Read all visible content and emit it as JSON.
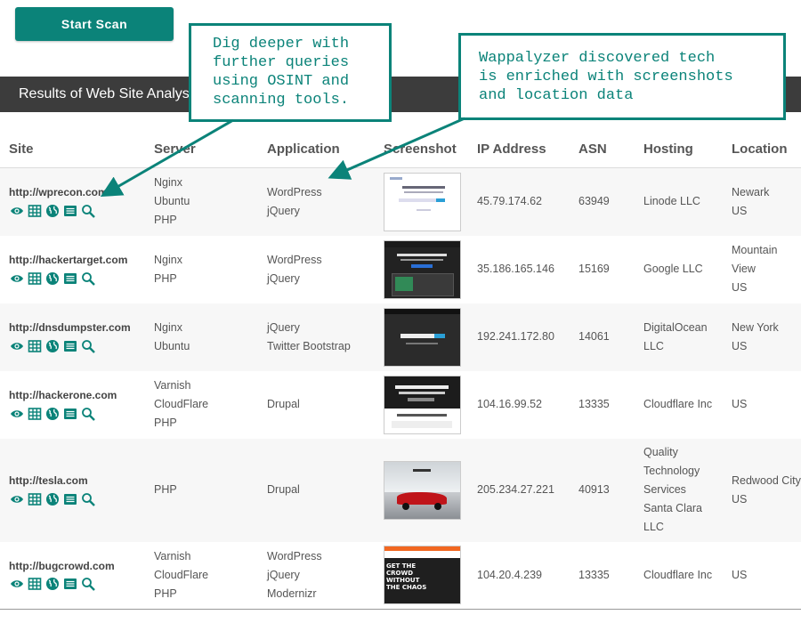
{
  "start_button": {
    "label": "Start Scan"
  },
  "results_header": {
    "title": "Results of Web Site Analysis"
  },
  "columns": [
    "Site",
    "Server",
    "Application",
    "Screenshot",
    "IP Address",
    "ASN",
    "Hosting",
    "Location"
  ],
  "rows": [
    {
      "site": "http://wprecon.com",
      "server": [
        "Nginx",
        "Ubuntu",
        "PHP"
      ],
      "application": [
        "WordPress",
        "jQuery"
      ],
      "ip": "45.79.174.62",
      "asn": "63949",
      "hosting": [
        "Linode LLC"
      ],
      "location": [
        "Newark",
        "US"
      ]
    },
    {
      "site": "http://hackertarget.com",
      "server": [
        "Nginx",
        "PHP"
      ],
      "application": [
        "WordPress",
        "jQuery"
      ],
      "ip": "35.186.165.146",
      "asn": "15169",
      "hosting": [
        "Google LLC"
      ],
      "location": [
        "Mountain",
        "View",
        "US"
      ]
    },
    {
      "site": "http://dnsdumpster.com",
      "server": [
        "Nginx",
        "Ubuntu"
      ],
      "application": [
        "jQuery",
        "Twitter Bootstrap"
      ],
      "ip": "192.241.172.80",
      "asn": "14061",
      "hosting": [
        "DigitalOcean",
        "LLC"
      ],
      "location": [
        "New York",
        "US"
      ]
    },
    {
      "site": "http://hackerone.com",
      "server": [
        "Varnish",
        "CloudFlare",
        "PHP"
      ],
      "application": [
        "Drupal"
      ],
      "ip": "104.16.99.52",
      "asn": "13335",
      "hosting": [
        "Cloudflare Inc"
      ],
      "location": [
        "",
        "US"
      ]
    },
    {
      "site": "http://tesla.com",
      "server": [
        "PHP"
      ],
      "application": [
        "Drupal"
      ],
      "ip": "205.234.27.221",
      "asn": "40913",
      "hosting": [
        "Quality",
        "Technology",
        "Services",
        "Santa Clara",
        "LLC"
      ],
      "location": [
        "Redwood City",
        "US"
      ]
    },
    {
      "site": "http://bugcrowd.com",
      "server": [
        "Varnish",
        "CloudFlare",
        "PHP"
      ],
      "application": [
        "WordPress",
        "jQuery",
        "Modernizr"
      ],
      "ip": "104.20.4.239",
      "asn": "13335",
      "hosting": [
        "Cloudflare Inc"
      ],
      "location": [
        "",
        "US"
      ]
    }
  ],
  "row_icons": [
    "eye-icon",
    "table-icon",
    "globe-icon",
    "list-icon",
    "search-icon"
  ],
  "screenshot_thumbs": [
    {
      "style": "light",
      "text": ""
    },
    {
      "style": "dark",
      "text": ""
    },
    {
      "style": "dark",
      "text": ""
    },
    {
      "style": "dark-light",
      "text": ""
    },
    {
      "style": "car",
      "text": ""
    },
    {
      "style": "bugcrowd",
      "text": "GET THE CROWD WITHOUT THE CHAOS"
    }
  ],
  "callouts": {
    "osint": [
      "Dig deeper with",
      "further queries",
      "using OSINT and",
      "scanning tools."
    ],
    "wappalyzer": [
      "Wappalyzer discovered tech",
      "is enriched with screenshots",
      "and location data"
    ]
  },
  "colors": {
    "accent": "#0b8379",
    "header_bar": "#3c3c3c",
    "row_alt": "#f7f7f7"
  }
}
